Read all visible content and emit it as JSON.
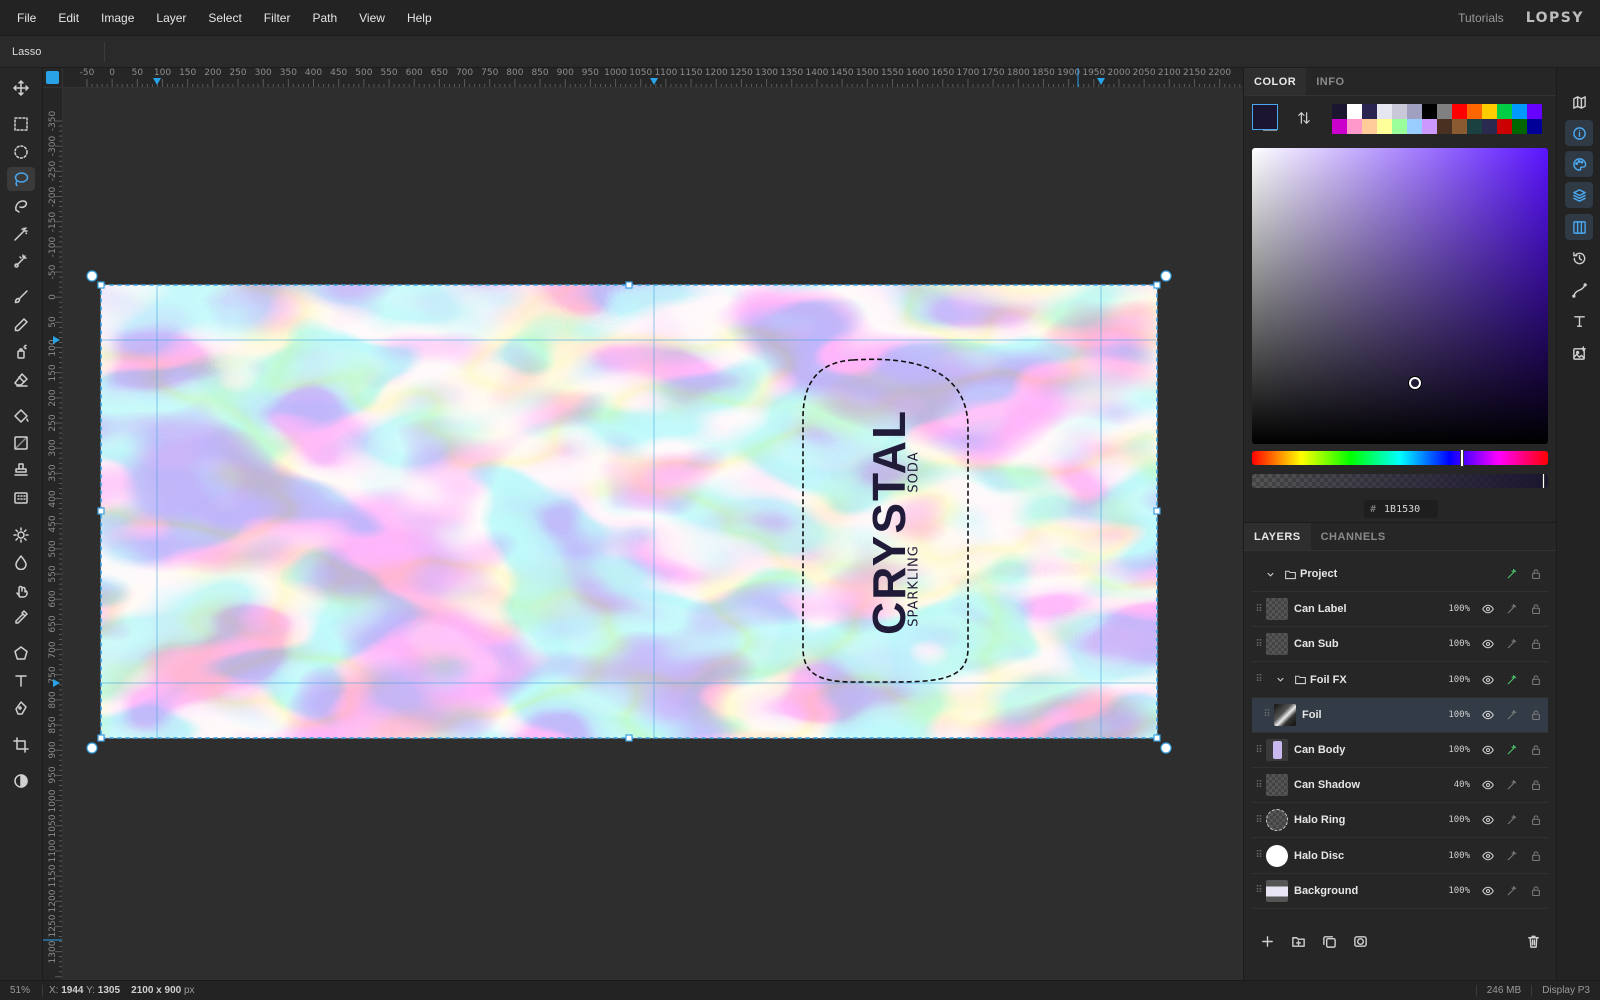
{
  "menu": {
    "items": [
      "File",
      "Edit",
      "Image",
      "Layer",
      "Select",
      "Filter",
      "Path",
      "View",
      "Help"
    ],
    "tutorials": "Tutorials",
    "logo": "LOPSY"
  },
  "options_bar": {
    "tool_name": "Lasso"
  },
  "tools": [
    {
      "name": "move-icon"
    },
    {
      "name": "rect-select-icon"
    },
    {
      "name": "ellipse-select-icon"
    },
    {
      "name": "lasso-icon",
      "active": true
    },
    {
      "name": "magnetic-lasso-icon"
    },
    {
      "name": "magic-wand-icon"
    },
    {
      "name": "quick-select-icon"
    },
    {
      "name": "brush-icon"
    },
    {
      "name": "pencil-icon"
    },
    {
      "name": "spray-icon"
    },
    {
      "name": "eraser-icon"
    },
    {
      "name": "fill-bucket-icon"
    },
    {
      "name": "gradient-icon"
    },
    {
      "name": "stamp-icon"
    },
    {
      "name": "pattern-icon"
    },
    {
      "name": "dodge-icon"
    },
    {
      "name": "blur-icon"
    },
    {
      "name": "smudge-icon"
    },
    {
      "name": "eyedropper-icon"
    },
    {
      "name": "polygon-icon"
    },
    {
      "name": "text-icon"
    },
    {
      "name": "pen-icon"
    },
    {
      "name": "crop-icon"
    },
    {
      "name": "contrast-icon"
    }
  ],
  "rulers": {
    "horizontal": [
      "-50",
      "0",
      "50",
      "100",
      "150",
      "200",
      "250",
      "300",
      "350",
      "400",
      "450",
      "500",
      "550",
      "600",
      "650",
      "700",
      "750",
      "800",
      "850",
      "900",
      "950",
      "1000",
      "1050",
      "1100",
      "1150",
      "1200",
      "1250",
      "1300",
      "1350",
      "1400",
      "1450",
      "1500",
      "1550",
      "1600",
      "1650",
      "1700",
      "1750",
      "1800",
      "1850",
      "1900",
      "1950",
      "2000",
      "2050",
      "2100",
      "2150",
      "2200"
    ],
    "vertical": [
      "-350",
      "-300",
      "-250",
      "-200",
      "-150",
      "-100",
      "-50",
      "0",
      "50",
      "100",
      "150",
      "200",
      "250",
      "300",
      "350",
      "400",
      "450",
      "500",
      "550",
      "600",
      "650",
      "700",
      "750",
      "800",
      "850",
      "900",
      "950",
      "1000",
      "1050",
      "1100",
      "1150",
      "1200",
      "1250",
      "1300"
    ]
  },
  "canvas": {
    "brand_title": "CRYSTAL",
    "brand_sub_left": "SPARKLING",
    "brand_sub_right": "SODA"
  },
  "color_panel": {
    "tabs": [
      "COLOR",
      "INFO"
    ],
    "foreground": "#1B1530",
    "background": "#FFFFFF",
    "hex_prefix": "#",
    "hex_value": "1B1530",
    "palette": [
      "#1b1530",
      "#ffffff",
      "#2a2550",
      "#e6e6f0",
      "#c8c8d8",
      "#a0a0c0",
      "#000000",
      "#808080",
      "#ff0000",
      "#ff6600",
      "#ffcc00",
      "#00cc44",
      "#0099ff",
      "#6600ff",
      "#cc00cc",
      "#ff99cc",
      "#ffcc99",
      "#ffff99",
      "#99ff99",
      "#99ccff",
      "#cc99ff",
      "#4a3020",
      "#8a5a30",
      "#1a4040",
      "#2a2a50",
      "#cc0000",
      "#006600",
      "#000099"
    ]
  },
  "layers_panel": {
    "tabs": [
      "LAYERS",
      "CHANNELS"
    ],
    "layers": [
      {
        "name": "Project",
        "opacity": "",
        "kind": "group",
        "indent": 0,
        "fx": true
      },
      {
        "name": "Can Label",
        "opacity": "100%",
        "kind": "layer",
        "indent": 1
      },
      {
        "name": "Can Sub",
        "opacity": "100%",
        "kind": "layer",
        "indent": 1
      },
      {
        "name": "Foil FX",
        "opacity": "100%",
        "kind": "group",
        "indent": 1,
        "fx": true
      },
      {
        "name": "Foil",
        "opacity": "100%",
        "kind": "layer",
        "indent": 2,
        "selected": true
      },
      {
        "name": "Can Body",
        "opacity": "100%",
        "kind": "layer",
        "indent": 1,
        "fx": true
      },
      {
        "name": "Can Shadow",
        "opacity": "40%",
        "kind": "layer",
        "indent": 1
      },
      {
        "name": "Halo Ring",
        "opacity": "100%",
        "kind": "layer",
        "indent": 1
      },
      {
        "name": "Halo Disc",
        "opacity": "100%",
        "kind": "layer",
        "indent": 1
      },
      {
        "name": "Background",
        "opacity": "100%",
        "kind": "layer",
        "indent": 1
      }
    ]
  },
  "right_strip": [
    {
      "name": "map-icon"
    },
    {
      "name": "info-icon",
      "active": true
    },
    {
      "name": "palette-icon",
      "active": true
    },
    {
      "name": "layers-icon",
      "active": true
    },
    {
      "name": "columns-icon",
      "active": true
    },
    {
      "name": "history-icon"
    },
    {
      "name": "curve-icon"
    },
    {
      "name": "type-icon"
    },
    {
      "name": "image-add-icon"
    }
  ],
  "status": {
    "zoom": "51%",
    "x_label": "X:",
    "x_value": "1944",
    "y_label": "Y:",
    "y_value": "1305",
    "doc_size": "2100 x 900",
    "doc_unit": "px",
    "memory": "246 MB",
    "color_profile": "Display P3"
  }
}
